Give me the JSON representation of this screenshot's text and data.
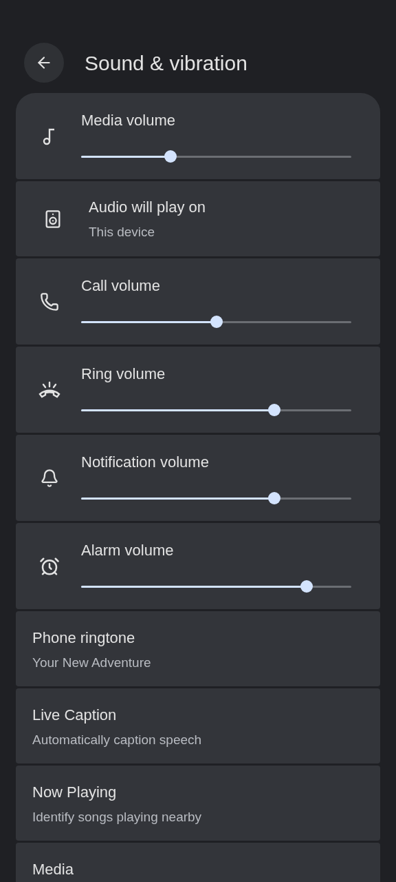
{
  "header": {
    "title": "Sound & vibration"
  },
  "items": [
    {
      "kind": "slider",
      "label": "Media volume",
      "level": 0.33
    },
    {
      "kind": "output",
      "label": "Audio will play on",
      "subtitle": "This device"
    },
    {
      "kind": "slider",
      "label": "Call volume",
      "level": 0.5
    },
    {
      "kind": "slider",
      "label": "Ring volume",
      "level": 0.715
    },
    {
      "kind": "slider",
      "label": "Notification volume",
      "level": 0.715
    },
    {
      "kind": "slider",
      "label": "Alarm volume",
      "level": 0.835
    },
    {
      "kind": "text",
      "label": "Phone ringtone",
      "subtitle": "Your New Adventure"
    },
    {
      "kind": "text",
      "label": "Live Caption",
      "subtitle": "Automatically caption speech"
    },
    {
      "kind": "text",
      "label": "Now Playing",
      "subtitle": "Identify songs playing nearby"
    },
    {
      "kind": "text",
      "label": "Media"
    }
  ]
}
